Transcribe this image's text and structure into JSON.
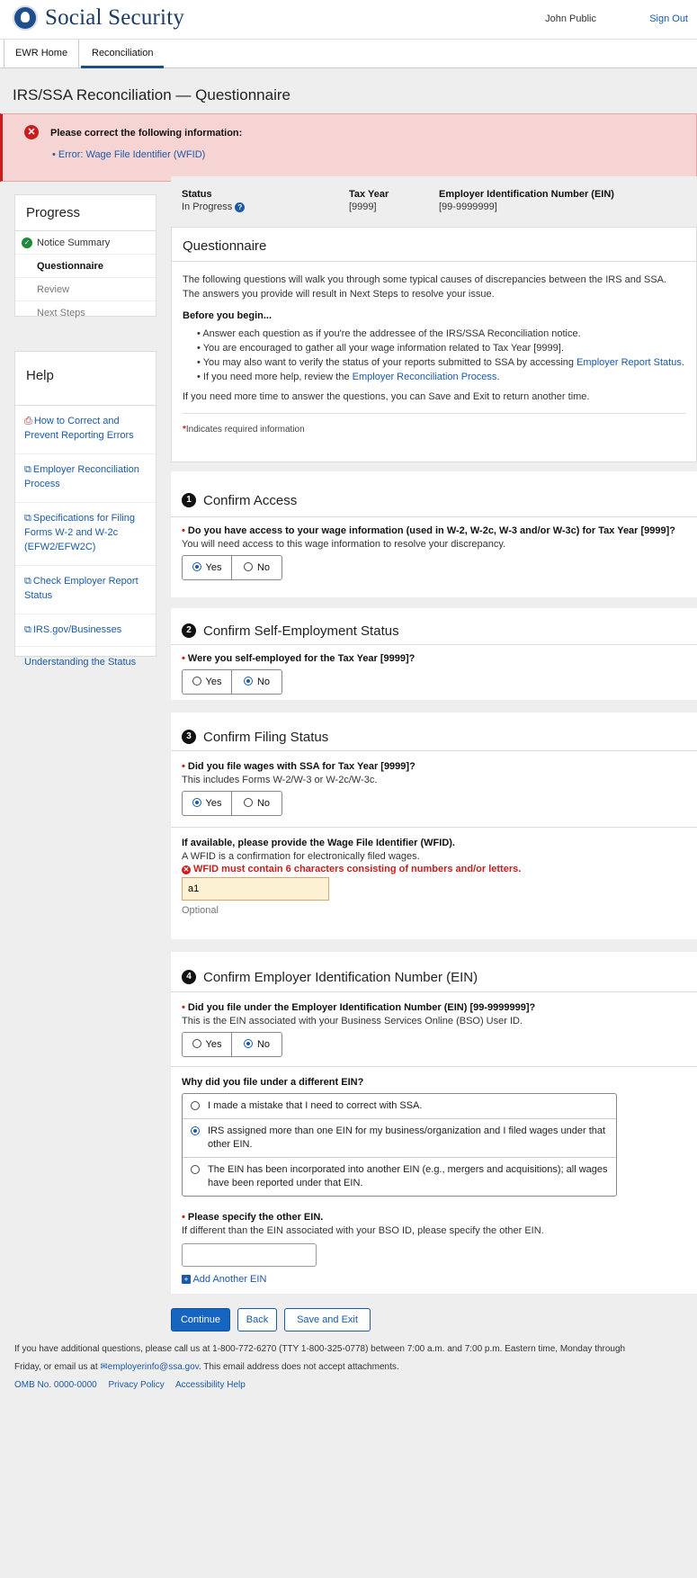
{
  "header": {
    "logo_text": "Social Security",
    "user_name": "John Public",
    "sign_out": "Sign Out"
  },
  "nav": {
    "tabs": [
      {
        "label": "EWR Home"
      },
      {
        "label": "Reconciliation"
      }
    ]
  },
  "page_title": "IRS/SSA Reconciliation — Questionnaire",
  "error_banner": {
    "title": "Please correct the following information:",
    "items": [
      "• Error: Wage File Identifier (WFID)"
    ]
  },
  "progress": {
    "title": "Progress",
    "steps": [
      {
        "label": "Notice Summary",
        "state": "complete"
      },
      {
        "label": "Questionnaire",
        "state": "current"
      },
      {
        "label": "Review",
        "state": "upcoming"
      },
      {
        "label": "Next Steps",
        "state": "upcoming"
      }
    ]
  },
  "help": {
    "title": "Help",
    "links": [
      {
        "label": "How to Correct and Prevent Reporting Errors",
        "icon": "pdf-icon"
      },
      {
        "label": "Employer Reconciliation Process",
        "icon": "external-link-icon"
      },
      {
        "label": "Specifications for Filing Forms W-2 and W-2c (EFW2/EFW2C)",
        "icon": "external-link-icon"
      },
      {
        "label": "Check Employer Report Status",
        "icon": "external-link-icon"
      },
      {
        "label": "IRS.gov/Businesses",
        "icon": "external-link-icon"
      },
      {
        "label": "Understanding the Status",
        "icon": ""
      }
    ]
  },
  "status_bar": {
    "status_label": "Status",
    "status_value": "In Progress",
    "tax_year_label": "Tax Year",
    "tax_year_value": "[9999]",
    "ein_label": "Employer Identification Number (EIN)",
    "ein_value": "[99-9999999]"
  },
  "intro": {
    "title": "Questionnaire",
    "paragraph": "The following questions will walk you through some typical causes of discrepancies between the IRS and SSA. The answers you provide will result in Next Steps to resolve your issue.",
    "before_title": "Before you begin...",
    "bullet1": "Answer each question as if you're the addressee of the IRS/SSA Reconciliation notice.",
    "bullet2": "You are encouraged to gather all your wage information related to Tax Year [9999].",
    "bullet3_text": "You may also want to verify the status of your reports submitted to SSA by accessing ",
    "bullet3_link": "Employer Report Status",
    "bullet3_end": ".",
    "bullet4_text": "If you need more help, review the ",
    "bullet4_link": "Employer Reconciliation Process",
    "bullet4_end": ".",
    "more_time": "If you need more time to answer the questions, you can Save and Exit to return another time.",
    "required_note": "Indicates required information"
  },
  "section1": {
    "number": "1",
    "title": "Confirm Access",
    "question": "Do you have access to your wage information (used in W-2, W-2c, W-3 and/or W-3c) for Tax Year [9999]?",
    "hint": "You will need access to this wage information to resolve your discrepancy.",
    "yes": "Yes",
    "no": "No",
    "selected": "Yes"
  },
  "section2": {
    "number": "2",
    "title": "Confirm Self-Employment Status",
    "question": "Were  you self-employed for the Tax Year [9999]?",
    "yes": "Yes",
    "no": "No",
    "selected": "No"
  },
  "section3": {
    "number": "3",
    "title": "Confirm Filing Status",
    "question": "Did you file wages with SSA for Tax Year [9999]?",
    "hint": "This includes Forms W-2/W-3 or W-2c/W-3c.",
    "yes": "Yes",
    "no": "No",
    "selected": "Yes",
    "wfid_label": "If available, please provide the Wage File Identifier (WFID).",
    "wfid_hint": "A WFID is a confirmation for electronically filed wages.",
    "wfid_error": "WFID must contain 6 characters consisting of numbers and/or letters.",
    "wfid_value": "a1",
    "wfid_optional": "Optional"
  },
  "section4": {
    "number": "4",
    "title": "Confirm Employer Identification Number (EIN)",
    "question": "Did you file under the Employer Identification Number (EIN) [99-9999999]?",
    "hint": "This is the EIN associated with your Business Services Online (BSO) User ID.",
    "yes": "Yes",
    "no": "No",
    "selected": "No",
    "why_label": "Why did you file under a different EIN?",
    "reasons": [
      {
        "label": "I made a mistake that I need to correct with SSA.",
        "selected": false
      },
      {
        "label": "IRS assigned more than one EIN for my business/organization and I filed wages under that other EIN.",
        "selected": true
      },
      {
        "label": "The EIN has been incorporated into another EIN (e.g., mergers and acquisitions); all wages have been reported under that EIN.",
        "selected": false
      }
    ],
    "other_ein_label": "Please specify the other EIN.",
    "other_ein_hint": "If different than the EIN associated with your BSO ID, please specify the other EIN.",
    "other_ein_value": "",
    "add_another": "Add Another EIN"
  },
  "actions": {
    "continue": "Continue",
    "back": "Back",
    "save_exit": "Save and Exit"
  },
  "footer": {
    "line1": "If you have additional questions, please call us at 1-800-772-6270 (TTY 1-800-325-0778) between 7:00 a.m. and 7:00 p.m. Eastern time, Monday through",
    "line2_pre": "Friday, or email us at ",
    "email": "employerinfo@ssa.gov",
    "line2_post": ". This email address does not accept attachments.",
    "omb": "OMB No. 0000-0000",
    "privacy": "Privacy Policy",
    "accessibility": "Accessibility Help"
  },
  "colors": {
    "brand_blue": "#1f4e8c",
    "link_blue": "#1a5aa8",
    "error_red": "#c91d1d",
    "error_bg": "#f7d4d4",
    "success_green": "#1d8a3a",
    "primary_button": "#1464c0"
  }
}
